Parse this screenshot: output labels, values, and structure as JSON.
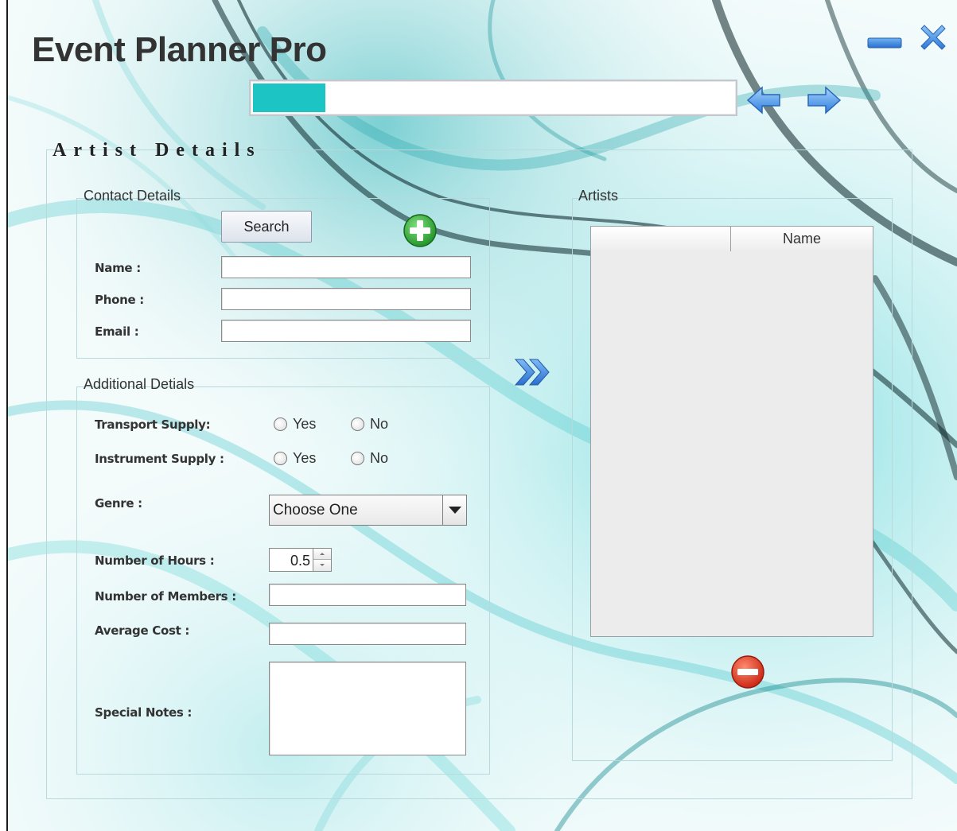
{
  "window": {
    "title": "Event Planner Pro"
  },
  "progress": {
    "value_percent": 15
  },
  "section": {
    "title": "Artist Details"
  },
  "contact": {
    "group_title": "Contact Details",
    "search_label": "Search",
    "name_label": "Name :",
    "phone_label": "Phone :",
    "email_label": "Email :",
    "name_value": "",
    "phone_value": "",
    "email_value": ""
  },
  "additional": {
    "group_title": "Additional Detials",
    "transport_label": "Transport Supply:",
    "instrument_label": "Instrument Supply :",
    "yes_label": "Yes",
    "no_label": "No",
    "genre_label": "Genre :",
    "genre_value": "Choose One",
    "hours_label": "Number of Hours :",
    "hours_value": "0.5",
    "members_label": "Number of Members :",
    "members_value": "",
    "cost_label": "Average Cost :",
    "cost_value": "",
    "notes_label": "Special Notes :",
    "notes_value": ""
  },
  "artists": {
    "group_title": "Artists",
    "columns": [
      "",
      "Name"
    ]
  },
  "icons": {
    "minimize": "minimize-icon",
    "close": "close-icon",
    "back": "arrow-left-icon",
    "forward": "arrow-right-icon",
    "add": "add-circle-icon",
    "remove": "remove-circle-icon",
    "transfer": "double-chevron-right-icon"
  },
  "colors": {
    "accent": "#1cc4c4",
    "nav_blue": "#3a8ee6",
    "add_green": "#2eaa2e",
    "remove_red": "#e23a2a"
  }
}
